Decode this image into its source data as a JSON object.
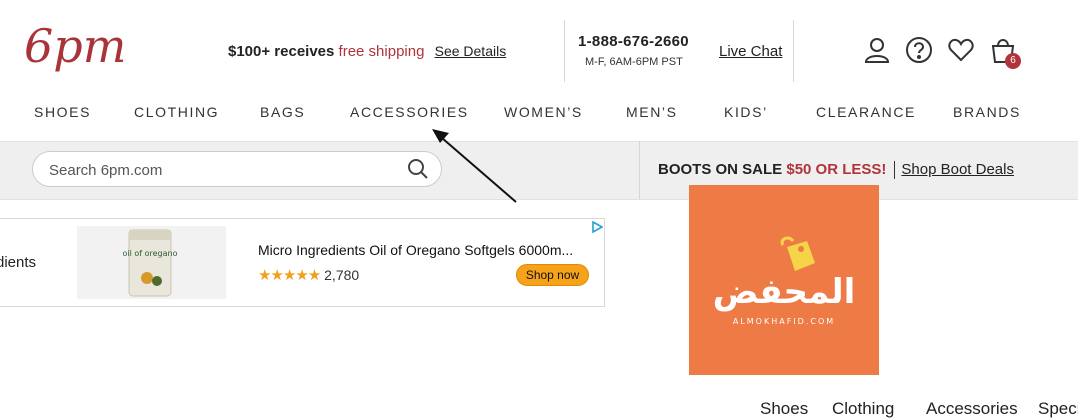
{
  "brand": {
    "logo_text": "6pm"
  },
  "header": {
    "shipping_prefix": "$100+ receives",
    "shipping_highlight": "free shipping",
    "see_details": "See Details",
    "phone": "1-888-676-2660",
    "hours": "M-F, 6AM-6PM PST",
    "live_chat": "Live Chat",
    "cart_count": "6"
  },
  "nav": {
    "items": [
      "SHOES",
      "CLOTHING",
      "BAGS",
      "ACCESSORIES",
      "WOMEN’S",
      "MEN’S",
      "KIDS’",
      "CLEARANCE",
      "BRANDS"
    ]
  },
  "search": {
    "placeholder": "Search 6pm.com"
  },
  "promo": {
    "text": "BOOTS ON SALE",
    "highlight": "$50 OR LESS!",
    "link": "Shop Boot Deals"
  },
  "ad": {
    "brand_partial": "dients",
    "product_label": "oil of oregano",
    "title": "Micro Ingredients Oil of Oregano Softgels 6000m...",
    "stars": "★★★★★",
    "reviews": "2,780",
    "button": "Shop now"
  },
  "overlay_logo": {
    "arabic": "المحفض",
    "latin": "ALMOKHAFID.COM"
  },
  "footer": {
    "items": [
      "Shoes",
      "Clothing",
      "Accessories",
      "Speci"
    ]
  },
  "colors": {
    "accent": "#b0343a",
    "orange": "#ee7b45",
    "cta": "#f7a21b"
  }
}
